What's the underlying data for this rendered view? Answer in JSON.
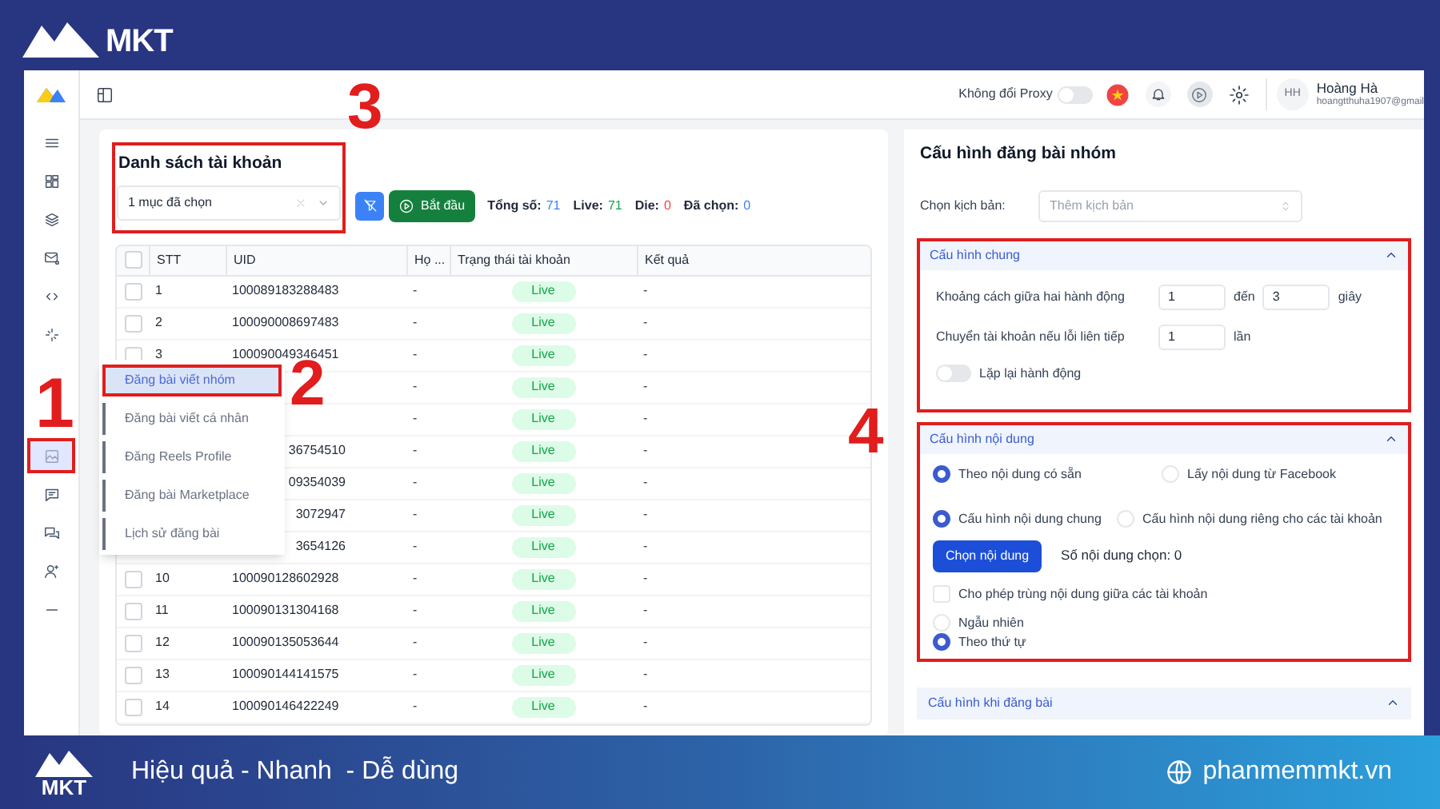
{
  "logo": {
    "text": "MKT"
  },
  "topbar": {
    "proxy_label": "Không đổi Proxy",
    "proxy_on": false,
    "avatar": "HH",
    "user_name": "Hoàng Hà",
    "user_email": "hoangtthuha1907@gmail"
  },
  "sidebar": {
    "items": [
      {
        "kind": "menu",
        "selected": false,
        "highlighted": false
      },
      {
        "kind": "grid",
        "selected": false,
        "highlighted": false
      },
      {
        "kind": "layers",
        "selected": false,
        "highlighted": false
      },
      {
        "kind": "mail",
        "selected": false,
        "highlighted": false
      },
      {
        "kind": "link",
        "selected": false,
        "highlighted": false
      },
      {
        "kind": "sparkle",
        "selected": false,
        "highlighted": false
      },
      {
        "kind": "image",
        "selected": true,
        "highlighted": true
      },
      {
        "kind": "chat",
        "selected": false,
        "highlighted": false
      },
      {
        "kind": "chats",
        "selected": false,
        "highlighted": false
      },
      {
        "kind": "user",
        "selected": false,
        "highlighted": false
      },
      {
        "kind": "dash",
        "selected": false,
        "highlighted": false
      }
    ]
  },
  "accounts": {
    "title": "Danh sách tài khoản",
    "highlighted": true,
    "select_value": "1 mục đã chọn",
    "start_button": "Bắt đầu",
    "stats": [
      {
        "label": "Tổng số:",
        "value": "71",
        "color": "#3b82f6"
      },
      {
        "label": "Live:",
        "value": "71",
        "color": "#16a34a"
      },
      {
        "label": "Die:",
        "value": "0",
        "color": "#ef4444"
      },
      {
        "label": "Đã chọn:",
        "value": "0",
        "color": "#3b82f6"
      }
    ],
    "all_checked": false,
    "columns": [
      "STT",
      "UID",
      "Họ ...",
      "Trạng thái tài khoản",
      "Kết quả"
    ],
    "rows": [
      {
        "stt": "1",
        "uid": "100089183288483",
        "name": "-",
        "status": "Live",
        "result": "-",
        "checked": false
      },
      {
        "stt": "2",
        "uid": "100090008697483",
        "name": "-",
        "status": "Live",
        "result": "-",
        "checked": false
      },
      {
        "stt": "3",
        "uid": "100090049346451",
        "name": "-",
        "status": "Live",
        "result": "-",
        "checked": false
      },
      {
        "name": "-",
        "status": "Live",
        "result": "-"
      },
      {
        "name": "-",
        "status": "Live",
        "result": "-"
      },
      {
        "uid": "36754510",
        "name": "-",
        "status": "Live",
        "result": "-"
      },
      {
        "uid": "09354039",
        "name": "-",
        "status": "Live",
        "result": "-"
      },
      {
        "uid": "3072947",
        "name": "-",
        "status": "Live",
        "result": "-"
      },
      {
        "uid": "3654126",
        "name": "-",
        "status": "Live",
        "result": "-"
      },
      {
        "stt": "10",
        "uid": "100090128602928",
        "name": "-",
        "status": "Live",
        "result": "-",
        "checked": false
      },
      {
        "stt": "11",
        "uid": "100090131304168",
        "name": "-",
        "status": "Live",
        "result": "-",
        "checked": false
      },
      {
        "stt": "12",
        "uid": "100090135053644",
        "name": "-",
        "status": "Live",
        "result": "-",
        "checked": false
      },
      {
        "stt": "13",
        "uid": "100090144141575",
        "name": "-",
        "status": "Live",
        "result": "-",
        "checked": false
      },
      {
        "stt": "14",
        "uid": "100090146422249",
        "name": "-",
        "status": "Live",
        "result": "-",
        "checked": false
      }
    ]
  },
  "submenu": {
    "items": [
      {
        "label": "Đăng bài viết nhóm",
        "selected": true,
        "highlighted": true
      },
      {
        "label": "Đăng bài viết cá nhân",
        "selected": false,
        "highlighted": false
      },
      {
        "label": "Đăng Reels Profile",
        "selected": false,
        "highlighted": false
      },
      {
        "label": "Đăng bài Marketplace",
        "selected": false,
        "highlighted": false
      },
      {
        "label": "Lịch sử đăng bài",
        "selected": false,
        "highlighted": false
      }
    ]
  },
  "config": {
    "title": "Cấu hình đăng bài nhóm",
    "script_label": "Chọn kịch bản:",
    "script_placeholder": "Thêm kịch bản",
    "general": {
      "header": "Cấu hình chung",
      "expanded": true,
      "highlighted": true,
      "interval_label": "Khoảng cách giữa hai hành động",
      "interval_from": "1",
      "to_label": "đến",
      "interval_to": "3",
      "unit": "giây",
      "switch_label": "Chuyển tài khoản nếu lỗi liên tiếp",
      "switch_value": "1",
      "switch_unit": "lần",
      "repeat_label": "Lặp lại hành động",
      "repeat_on": false
    },
    "content": {
      "header": "Cấu hình nội dung",
      "expanded": true,
      "highlighted": true,
      "radio_groups": [
        [
          {
            "label": "Theo nội dung có sẵn",
            "selected": true
          },
          {
            "label": "Lấy nội dung từ Facebook",
            "selected": false
          }
        ],
        [
          {
            "label": "Cấu hình nội dung chung",
            "selected": true
          },
          {
            "label": "Cấu hình nội dung riêng cho các tài khoản",
            "selected": false
          }
        ]
      ],
      "choose_button": "Chọn nội dung",
      "count_text": "Số nội dung chọn: 0",
      "allow_duplicate_label": "Cho phép trùng nội dung giữa các tài khoản",
      "allow_duplicate": false,
      "order_options": [
        {
          "label": "Ngẫu nhiên",
          "selected": false
        },
        {
          "label": "Theo thứ tự",
          "selected": true
        }
      ]
    },
    "posting": {
      "header": "Cấu hình khi đăng bài",
      "expanded": true,
      "highlighted": false
    }
  },
  "annotations": [
    {
      "label": "1"
    },
    {
      "label": "2"
    },
    {
      "label": "3"
    },
    {
      "label": "4"
    }
  ],
  "banner": {
    "logo_text": "MKT",
    "slogan": "Hiệu quả - Nhanh  - Dễ dùng",
    "site": "phanmemmkt.vn"
  }
}
